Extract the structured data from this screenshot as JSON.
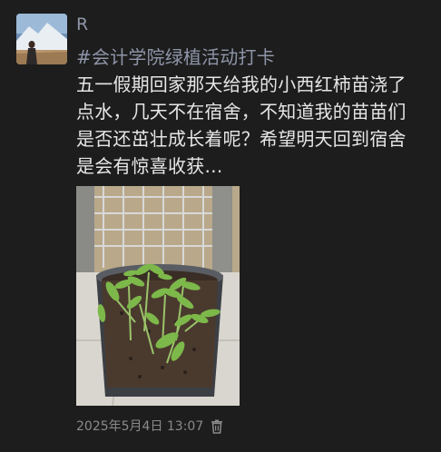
{
  "post": {
    "username": "R",
    "hashtag": "#会计学院绿植活动打卡",
    "body_lines": [
      "五一假期回家那天给我的小西红柿苗浇了",
      "点水，几天不在宿舍，不知道我的苗苗们",
      "是否还茁壮成长着呢？希望明天回到宿舍",
      "是会有惊喜收获…"
    ],
    "timestamp": "2025年5月4日 13:07"
  },
  "icons": {
    "delete": "trash-icon"
  },
  "colors": {
    "background": "#1d1d1d",
    "username": "#8e95a8",
    "hashtag": "#8e95a8",
    "body_text": "#e6e6e6",
    "meta_text": "#8a8a8a"
  }
}
